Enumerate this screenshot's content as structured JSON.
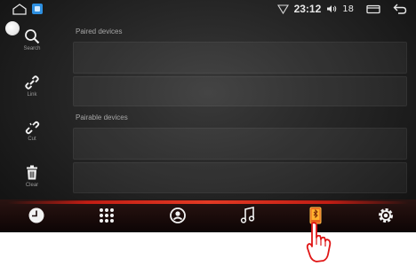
{
  "statusbar": {
    "time": "23:12",
    "volume_icon": "volume-icon",
    "volume_level": "18"
  },
  "sidebar": {
    "items": [
      {
        "label": "Search",
        "icon": "search-icon"
      },
      {
        "label": "Link",
        "icon": "link-icon"
      },
      {
        "label": "Cut",
        "icon": "unlink-icon"
      },
      {
        "label": "Clear",
        "icon": "trash-icon"
      }
    ]
  },
  "content": {
    "paired_label": "Paired devices",
    "pairable_label": "Pairable devices"
  },
  "dock": {
    "items": [
      "clock-icon",
      "apps-grid-icon",
      "radio-icon",
      "music-icon",
      "bluetooth-phone-icon",
      "settings-icon"
    ],
    "active_index": 4
  },
  "colors": {
    "accent_red": "#d9261a",
    "text_gray": "#a8a8a8",
    "status_app_blue": "#2d8fe0"
  }
}
